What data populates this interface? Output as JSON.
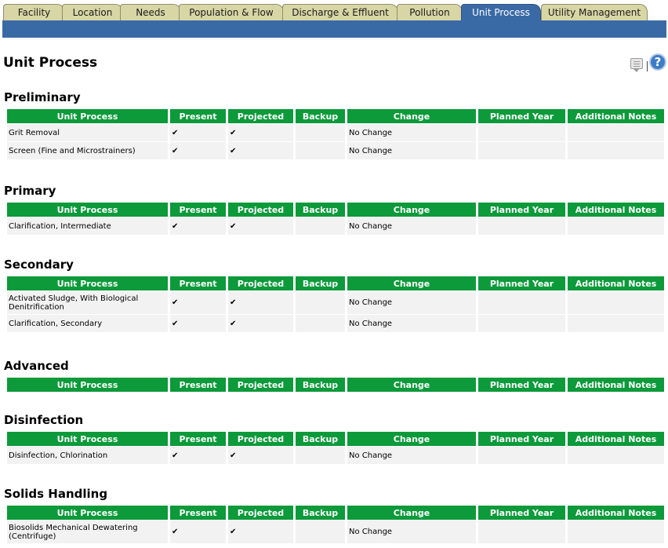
{
  "tabs": [
    {
      "label": "Facility",
      "active": false
    },
    {
      "label": "Location",
      "active": false
    },
    {
      "label": "Needs",
      "active": false
    },
    {
      "label": "Population & Flow",
      "active": false
    },
    {
      "label": "Discharge & Effluent",
      "active": false
    },
    {
      "label": "Pollution",
      "active": false
    },
    {
      "label": "Unit Process",
      "active": true
    },
    {
      "label": "Utility Management",
      "active": false
    }
  ],
  "page_title": "Unit Process",
  "icons": {
    "comment": "comment-icon",
    "help": "help-icon",
    "help_glyph": "?"
  },
  "colors": {
    "tab_inactive": "#d8d6a4",
    "tab_active": "#3a6aa6",
    "header_green": "#0c9a3a"
  },
  "columns": [
    "Unit Process",
    "Present",
    "Projected",
    "Backup",
    "Change",
    "Planned Year",
    "Additional Notes"
  ],
  "check_glyph": "✔",
  "sections": [
    {
      "title": "Preliminary",
      "rows": [
        {
          "unit": "Grit Removal",
          "present": true,
          "projected": true,
          "backup": false,
          "change": "No Change",
          "planned_year": "",
          "notes": ""
        },
        {
          "unit": "Screen (Fine and Microstrainers)",
          "present": true,
          "projected": true,
          "backup": false,
          "change": "No Change",
          "planned_year": "",
          "notes": ""
        }
      ]
    },
    {
      "title": "Primary",
      "rows": [
        {
          "unit": "Clarification, Intermediate",
          "present": true,
          "projected": true,
          "backup": false,
          "change": "No Change",
          "planned_year": "",
          "notes": ""
        }
      ]
    },
    {
      "title": "Secondary",
      "rows": [
        {
          "unit": "Activated Sludge, With Biological Denitrification",
          "present": true,
          "projected": true,
          "backup": false,
          "change": "No Change",
          "planned_year": "",
          "notes": ""
        },
        {
          "unit": "Clarification, Secondary",
          "present": true,
          "projected": true,
          "backup": false,
          "change": "No Change",
          "planned_year": "",
          "notes": ""
        }
      ]
    },
    {
      "title": "Advanced",
      "rows": []
    },
    {
      "title": "Disinfection",
      "rows": [
        {
          "unit": "Disinfection, Chlorination",
          "present": true,
          "projected": true,
          "backup": false,
          "change": "No Change",
          "planned_year": "",
          "notes": ""
        }
      ]
    },
    {
      "title": "Solids Handling",
      "rows": [
        {
          "unit": "Biosolids Mechanical Dewatering (Centrifuge)",
          "present": true,
          "projected": true,
          "backup": false,
          "change": "No Change",
          "planned_year": "",
          "notes": ""
        }
      ]
    }
  ]
}
